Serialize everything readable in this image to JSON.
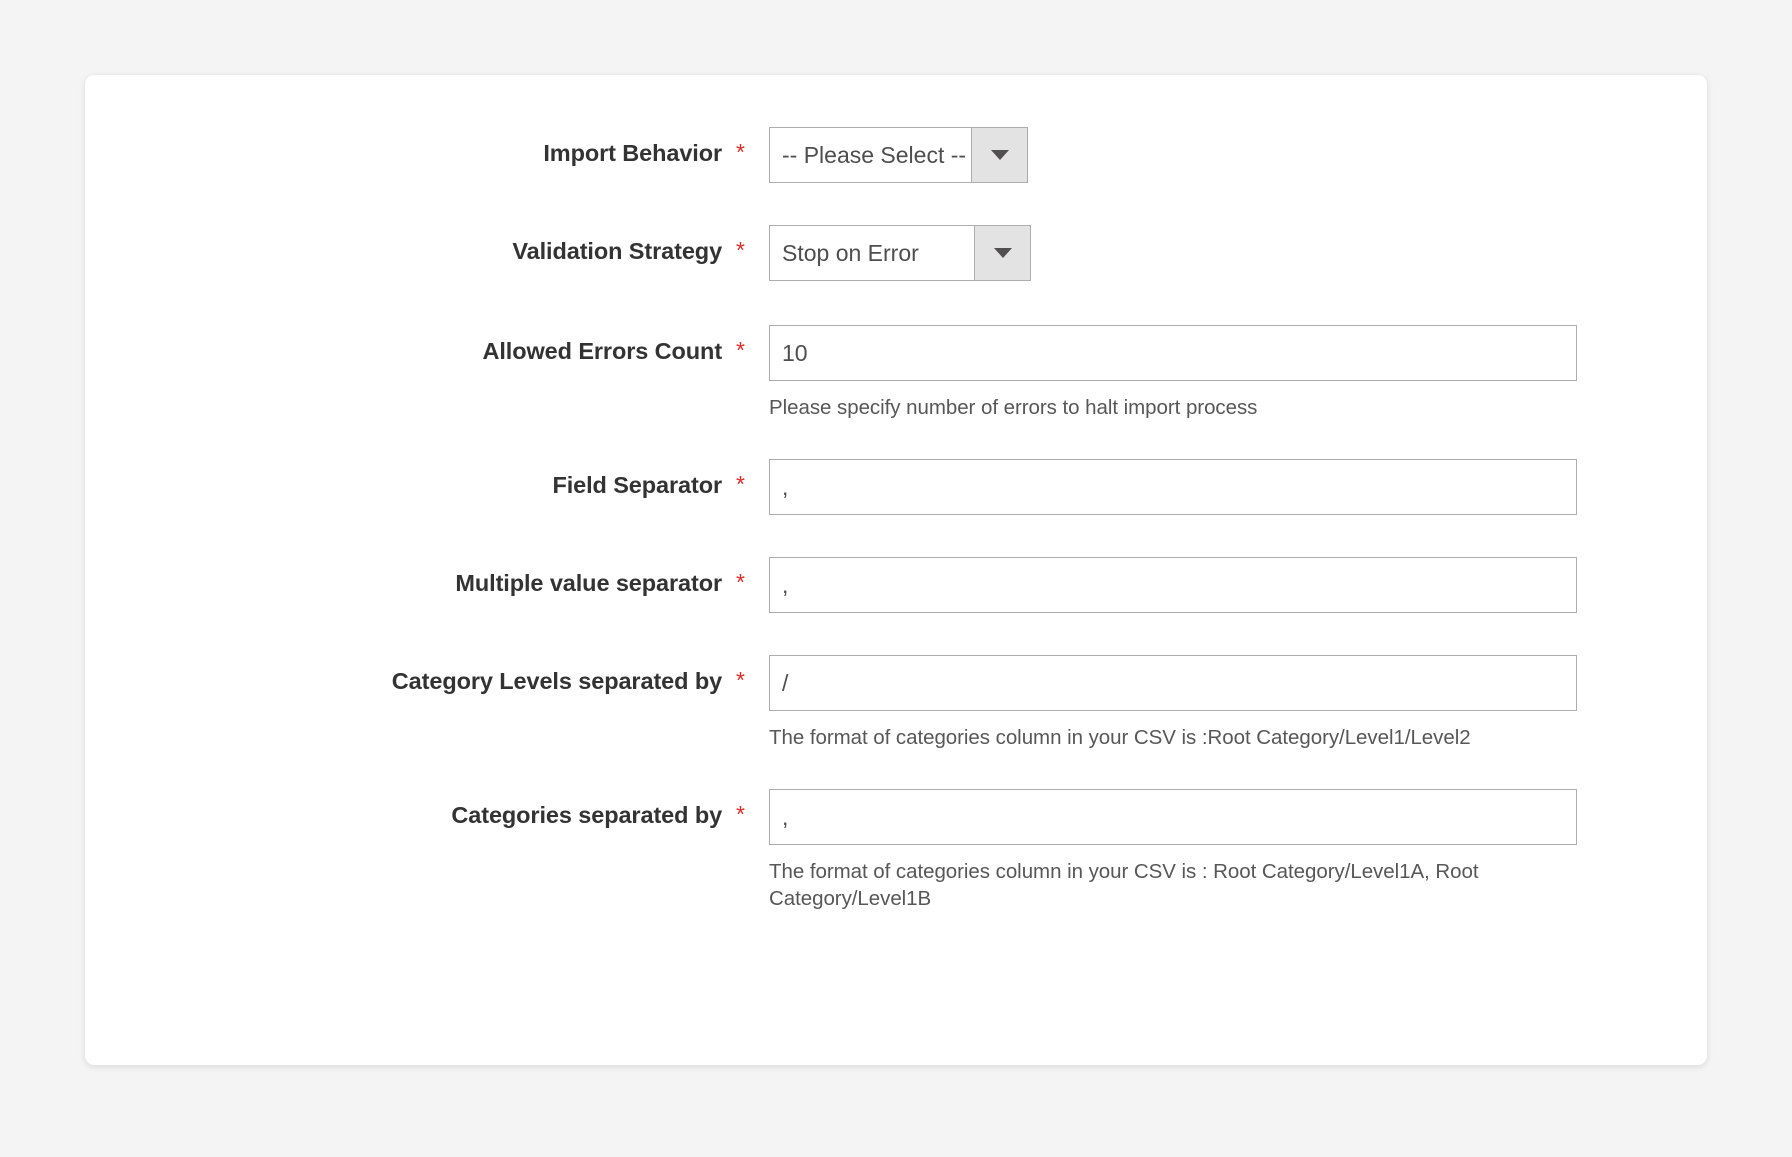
{
  "form": {
    "required_mark": "*",
    "fields": [
      {
        "id": "import-behavior",
        "label": "Import Behavior",
        "type": "select",
        "value": "-- Please Select --",
        "note": ""
      },
      {
        "id": "validation-strategy",
        "label": "Validation Strategy",
        "type": "select",
        "value": "Stop on Error",
        "note": ""
      },
      {
        "id": "allowed-errors-count",
        "label": "Allowed Errors Count",
        "type": "text",
        "value": "10",
        "note": "Please specify number of errors to halt import process"
      },
      {
        "id": "field-separator",
        "label": "Field Separator",
        "type": "text",
        "value": ",",
        "note": ""
      },
      {
        "id": "multiple-value-separator",
        "label": "Multiple value separator",
        "type": "text",
        "value": ",",
        "note": ""
      },
      {
        "id": "category-levels-separated-by",
        "label": "Category Levels separated by",
        "type": "text",
        "value": "/",
        "note": "The format of categories column in your CSV is :Root Category/Level1/Level2"
      },
      {
        "id": "categories-separated-by",
        "label": "Categories separated by",
        "type": "text",
        "value": ",",
        "note": "The format of categories column in your CSV is : Root Category/Level1A, Root Category/Level1B"
      }
    ]
  },
  "colors": {
    "page_background": "#f4f4f4",
    "card_background": "#ffffff",
    "label_text": "#333333",
    "required_asterisk": "#e02b27",
    "input_border": "#adadad",
    "input_text": "#4e4e4e",
    "note_text": "#575757",
    "select_button_background": "#e3e3e3"
  }
}
